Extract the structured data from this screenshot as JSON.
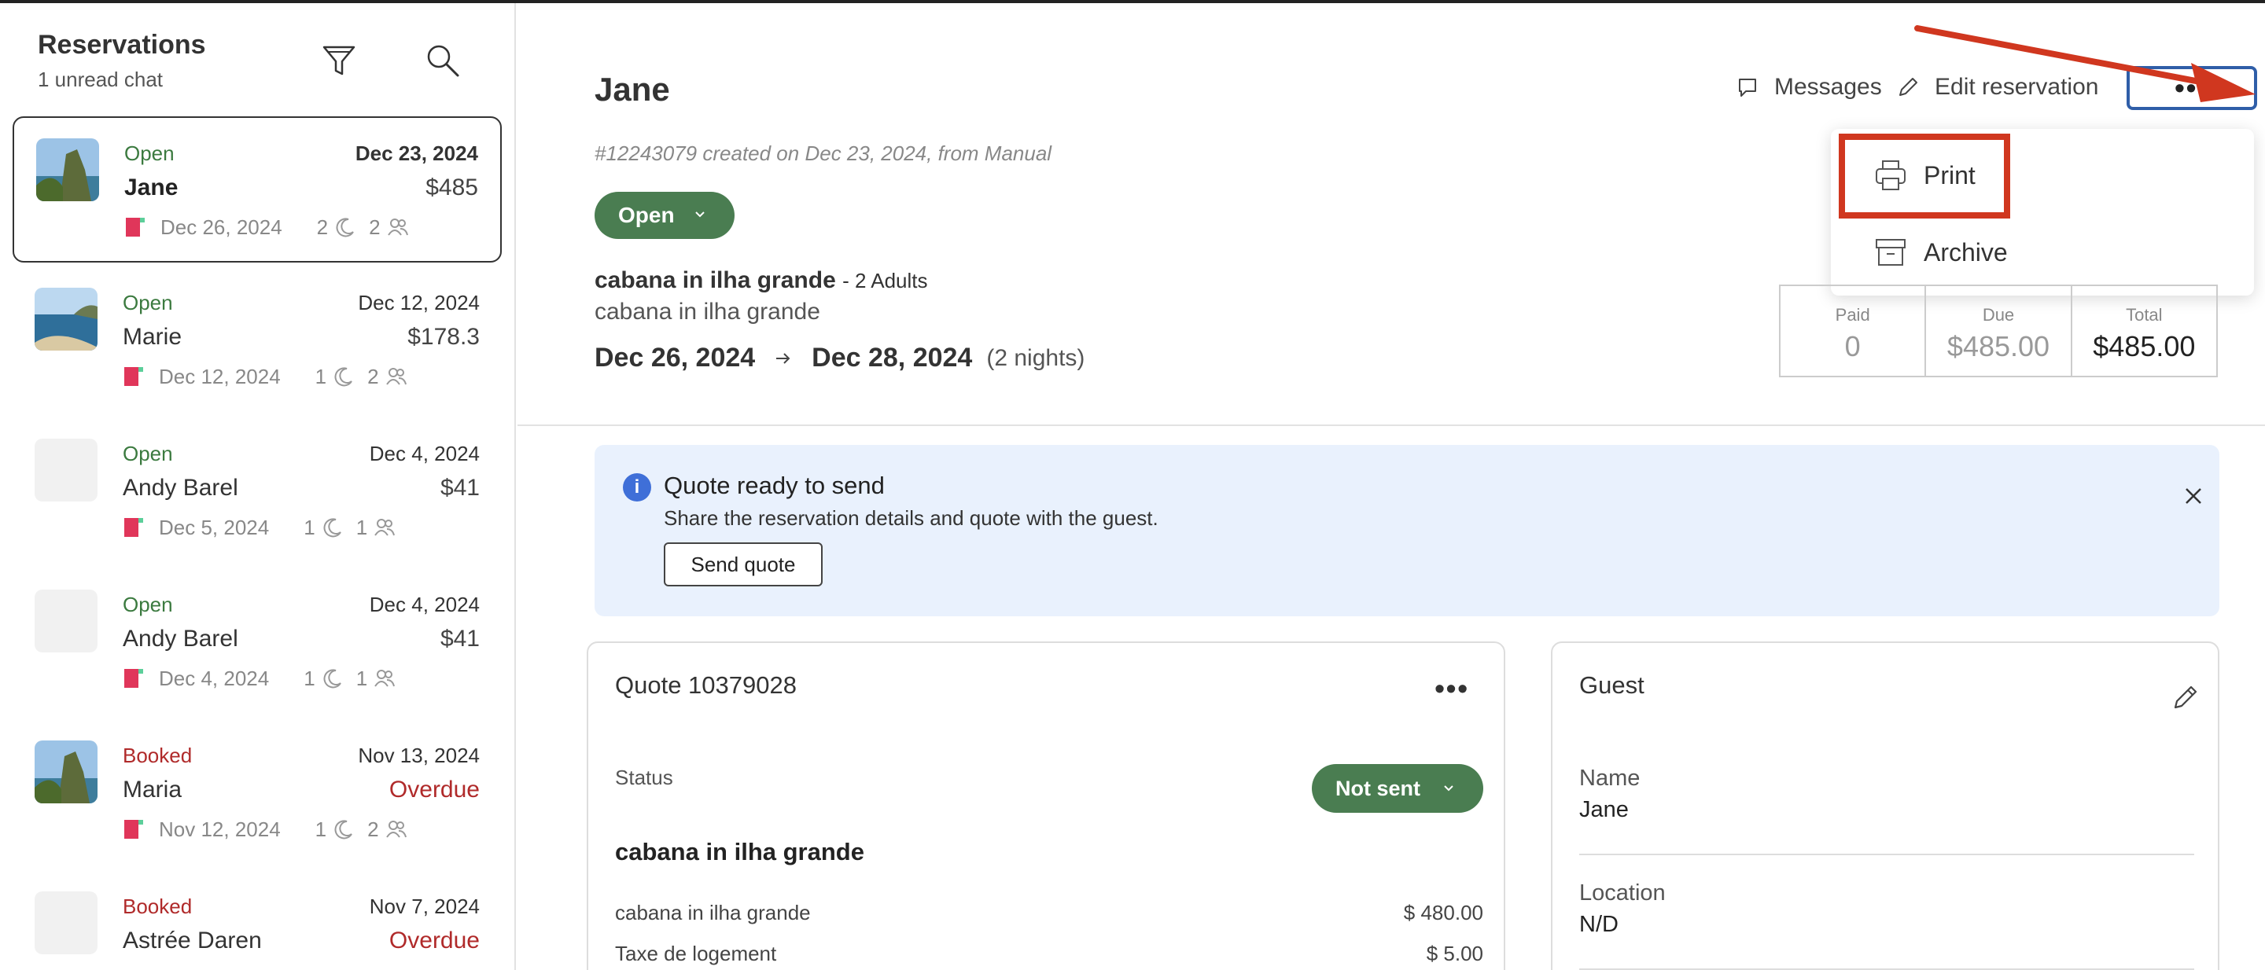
{
  "sidebar": {
    "title": "Reservations",
    "subtitle": "1 unread chat",
    "reservations": [
      {
        "status": "Open",
        "date": "Dec 23, 2024",
        "name": "Jane",
        "amount": "$485",
        "checkin": "Dec 26, 2024",
        "nights": "2",
        "guests": "2"
      },
      {
        "status": "Open",
        "date": "Dec 12, 2024",
        "name": "Marie",
        "amount": "$178.3",
        "checkin": "Dec 12, 2024",
        "nights": "1",
        "guests": "2"
      },
      {
        "status": "Open",
        "date": "Dec 4, 2024",
        "name": "Andy Barel",
        "amount": "$41",
        "checkin": "Dec 5, 2024",
        "nights": "1",
        "guests": "1"
      },
      {
        "status": "Open",
        "date": "Dec 4, 2024",
        "name": "Andy Barel",
        "amount": "$41",
        "checkin": "Dec 4, 2024",
        "nights": "1",
        "guests": "1"
      },
      {
        "status": "Booked",
        "date": "Nov 13, 2024",
        "name": "Maria",
        "amount": "Overdue",
        "checkin": "Nov 12, 2024",
        "nights": "1",
        "guests": "2"
      },
      {
        "status": "Booked",
        "date": "Nov 7, 2024",
        "name": "Astrée Daren",
        "amount": "Overdue",
        "checkin": "",
        "nights": "",
        "guests": ""
      }
    ]
  },
  "header": {
    "guest_name": "Jane",
    "reservation_info": "#12243079 created on Dec 23, 2024, from Manual",
    "status_label": "Open",
    "listing_name": "cabana in ilha grande",
    "guests_text": "- 2 Adults",
    "listing_sub": "cabana in ilha grande",
    "checkin": "Dec 26, 2024",
    "checkout": "Dec 28, 2024",
    "nights": "(2 nights)",
    "messages_label": "Messages",
    "edit_label": "Edit reservation",
    "more_label": "•••"
  },
  "menu": {
    "items": [
      {
        "label": "Print",
        "icon": "printer-icon"
      },
      {
        "label": "Archive",
        "icon": "archive-icon"
      }
    ]
  },
  "totals": {
    "paid_label": "Paid",
    "paid_value": "0",
    "due_label": "Due",
    "due_value": "$485.00",
    "total_label": "Total",
    "total_value": "$485.00"
  },
  "banner": {
    "title": "Quote ready to send",
    "text": "Share the reservation details and quote with the guest.",
    "button": "Send quote"
  },
  "quote": {
    "title": "Quote 10379028",
    "more": "•••",
    "status_label": "Status",
    "status_value": "Not sent",
    "listing": "cabana in ilha grande",
    "lines": [
      {
        "label": "cabana in ilha grande",
        "value": "$ 480.00"
      },
      {
        "label": "Taxe de logement",
        "value": "$ 5.00"
      }
    ]
  },
  "guest": {
    "title": "Guest",
    "name_label": "Name",
    "name_value": "Jane",
    "location_label": "Location",
    "location_value": "N/D"
  },
  "colors": {
    "open_green": "#3b7a3f",
    "pill_green": "#4a7d51",
    "booked_red": "#b02a2a",
    "annotation_red": "#d0371f",
    "focus_blue": "#2f5ea8",
    "banner_bg": "#e9f1fd"
  }
}
